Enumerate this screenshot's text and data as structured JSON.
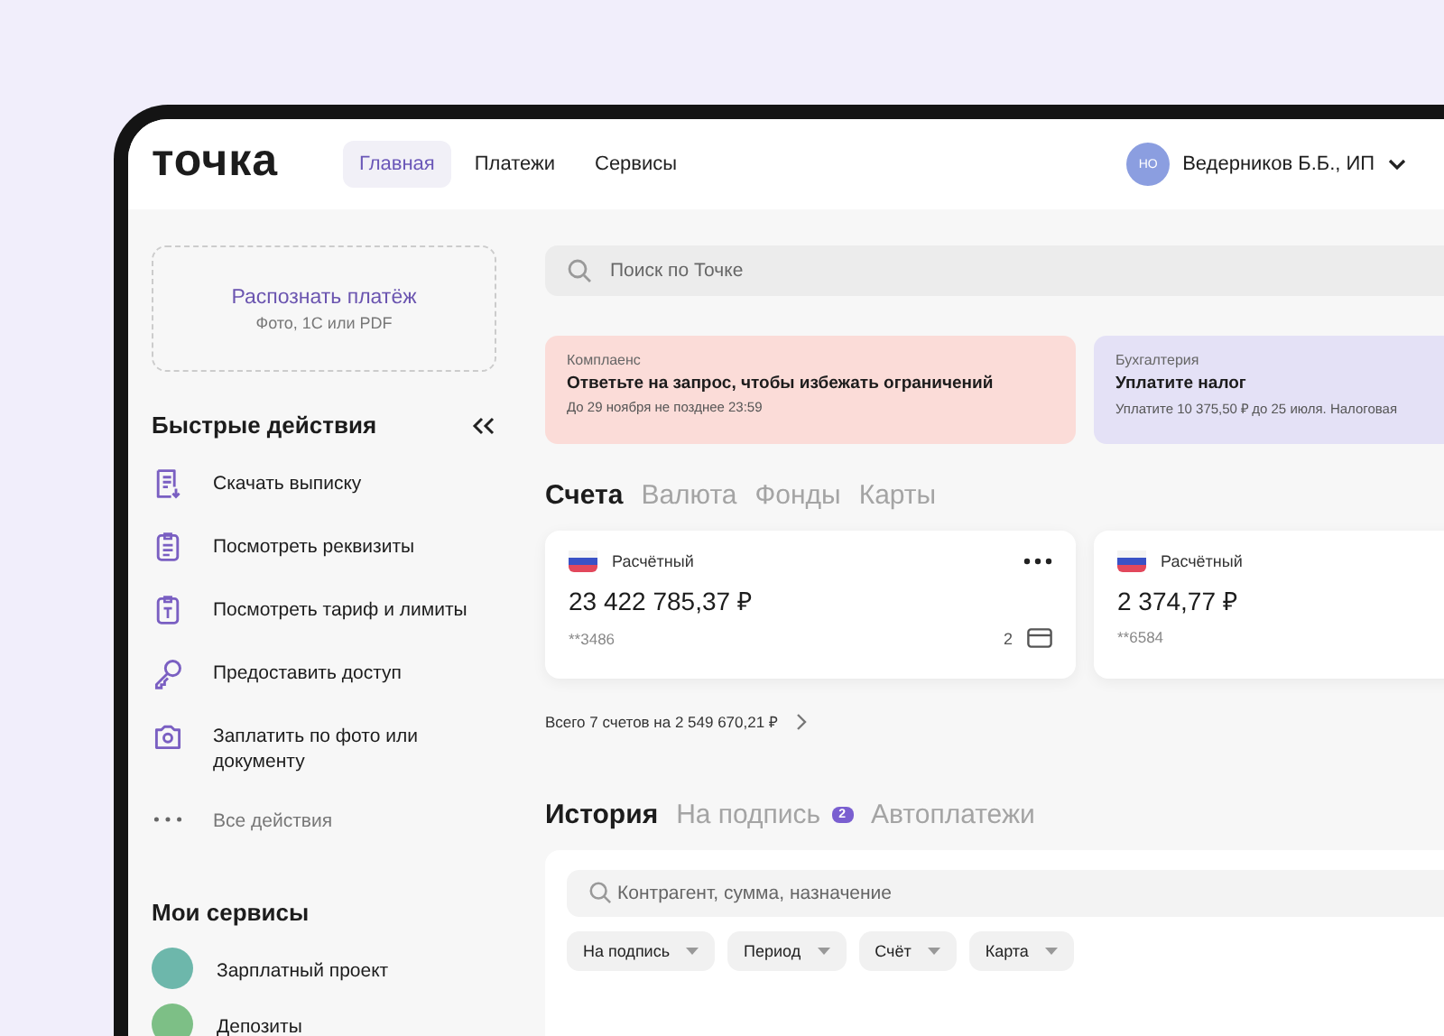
{
  "header": {
    "logo": "точка",
    "nav": [
      {
        "label": "Главная",
        "selected": true
      },
      {
        "label": "Платежи",
        "selected": false
      },
      {
        "label": "Сервисы",
        "selected": false
      }
    ],
    "user": {
      "initials": "НО",
      "name": "Ведерников Б.Б., ИП"
    }
  },
  "sidebar": {
    "recognize": {
      "title": "Распознать платёж",
      "subtitle": "Фото, 1С или PDF"
    },
    "quick_actions": {
      "title": "Быстрые действия",
      "items": [
        {
          "label": "Скачать выписку"
        },
        {
          "label": "Посмотреть реквизиты"
        },
        {
          "label": "Посмотреть тариф и лимиты"
        },
        {
          "label": "Предоставить доступ"
        },
        {
          "label": "Заплатить по фото или документу"
        }
      ],
      "all_actions": "Все действия"
    },
    "services": {
      "title": "Мои сервисы",
      "items": [
        {
          "label": "Зарплатный проект",
          "color": "#6db7ab"
        },
        {
          "label": "Депозиты",
          "color": "#7dbf86"
        }
      ]
    }
  },
  "search": {
    "placeholder": "Поиск по Точке"
  },
  "notifications": [
    {
      "category": "Комплаенс",
      "title": "Ответьте на запрос, чтобы избежать ограничений",
      "text": "До 29 ноября не позднее 23:59",
      "color": "#fbdcd8"
    },
    {
      "category": "Бухгалтерия",
      "title": "Уплатите налог",
      "text": "Уплатите 10 375,50 ₽ до 25 июля. Налоговая",
      "color": "#e4e1f6"
    }
  ],
  "accounts": {
    "tabs": [
      {
        "label": "Счета",
        "selected": true
      },
      {
        "label": "Валюта",
        "selected": false
      },
      {
        "label": "Фонды",
        "selected": false
      },
      {
        "label": "Карты",
        "selected": false
      }
    ],
    "cards": [
      {
        "type": "Расчётный",
        "balance": "23 422 785,37 ₽",
        "number": "**3486",
        "menu": true,
        "cards_count": "2"
      },
      {
        "type": "Расчётный",
        "balance": "2 374,77 ₽",
        "number": "**6584"
      }
    ],
    "total": "Всего 7 счетов на 2 549 670,21 ₽"
  },
  "history": {
    "tabs": [
      {
        "label": "История",
        "selected": true
      },
      {
        "label": "На подпись",
        "selected": false,
        "badge": "2"
      },
      {
        "label": "Автоплатежи",
        "selected": false
      }
    ],
    "search": {
      "placeholder": "Контрагент, сумма, назначение"
    },
    "filters": [
      "На подпись",
      "Период",
      "Счёт",
      "Карта"
    ]
  }
}
